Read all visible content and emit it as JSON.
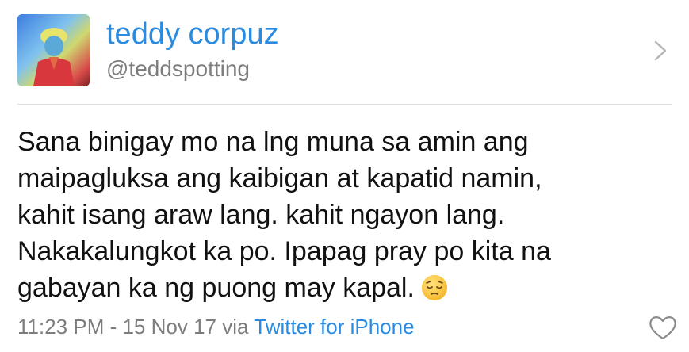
{
  "tweet": {
    "author": {
      "display_name": "teddy corpuz",
      "handle": "@teddspotting"
    },
    "text_lines": [
      "Sana binigay mo na lng muna sa amin ang",
      "maipagluksa ang kaibigan at kapatid namin,",
      "kahit isang araw lang. kahit ngayon lang.",
      "Nakakalungkot ka po. Ipapag pray po kita na",
      "gabayan ka ng puong may kapal."
    ],
    "emoji": "pensive-face",
    "timestamp": "11:23 PM - 15 Nov 17",
    "via_label": "via",
    "source": "Twitter for iPhone"
  },
  "icons": {
    "chevron": "chevron-right-icon",
    "like": "heart-outline-icon"
  },
  "colors": {
    "name_blue": "#2a8be0",
    "muted_gray": "#7d7d7d",
    "text": "#111111",
    "divider": "#dcdcdc"
  }
}
